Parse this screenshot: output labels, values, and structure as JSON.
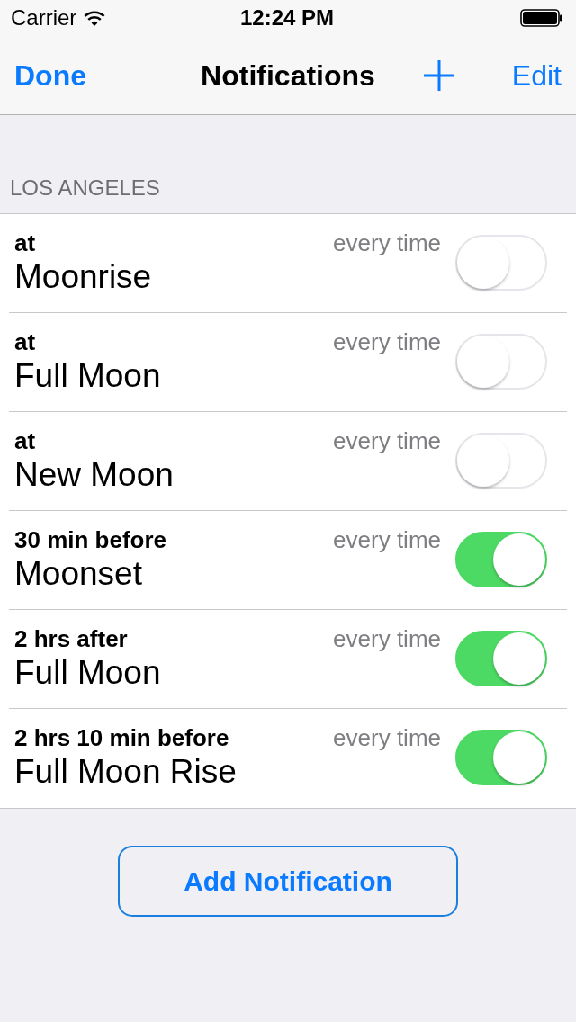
{
  "status_bar": {
    "carrier": "Carrier",
    "time": "12:24 PM"
  },
  "nav_bar": {
    "left_button": "Done",
    "title": "Notifications",
    "right_button": "Edit"
  },
  "section": {
    "header": "LOS ANGELES",
    "rows": [
      {
        "offset": "at",
        "event": "Moonrise",
        "repeat": "every time",
        "on": false
      },
      {
        "offset": "at",
        "event": "Full Moon",
        "repeat": "every time",
        "on": false
      },
      {
        "offset": "at",
        "event": "New Moon",
        "repeat": "every time",
        "on": false
      },
      {
        "offset": "30 min before",
        "event": "Moonset",
        "repeat": "every time",
        "on": true
      },
      {
        "offset": "2 hrs after",
        "event": "Full Moon",
        "repeat": "every time",
        "on": true
      },
      {
        "offset": "2 hrs 10 min before",
        "event": "Full Moon Rise",
        "repeat": "every time",
        "on": true
      }
    ]
  },
  "add_button": "Add Notification"
}
